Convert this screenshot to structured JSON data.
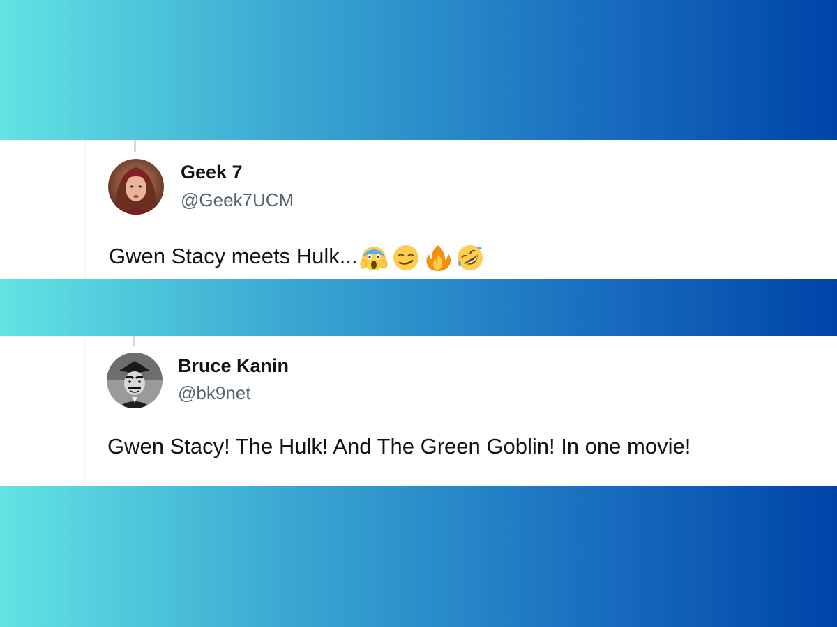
{
  "tweets": [
    {
      "name": "Geek 7",
      "handle": "@Geek7UCM",
      "text": "Gwen Stacy meets Hulk...",
      "emojis": [
        "scream-emoji",
        "smirk-emoji",
        "fire-emoji",
        "rofl-emoji"
      ]
    },
    {
      "name": "Bruce Kanin",
      "handle": "@bk9net",
      "text": "Gwen Stacy! The Hulk! And The Green Goblin! In one movie!"
    }
  ],
  "colors": {
    "gradient_start": "#62e3e3",
    "gradient_end": "#0044a8",
    "name_text": "#0f1419",
    "handle_text": "#536471",
    "thread_line": "#cfd9de"
  }
}
